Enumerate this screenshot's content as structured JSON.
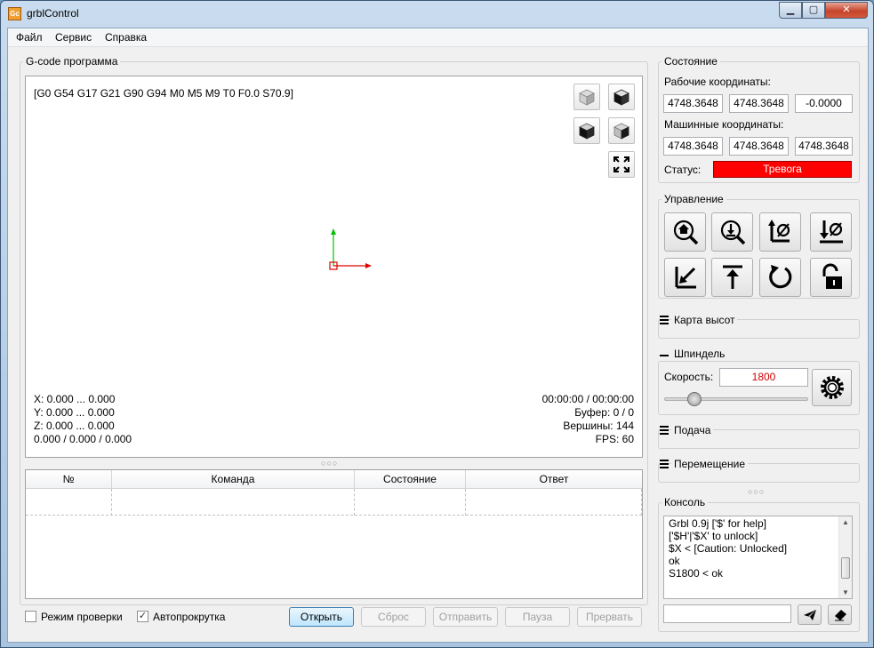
{
  "window": {
    "title": "grblControl",
    "app_icon_text": "Gc"
  },
  "menu": {
    "items": [
      "Файл",
      "Сервис",
      "Справка"
    ]
  },
  "program": {
    "group_title": "G-code программа",
    "gcode_header": "[G0 G54 G17 G21 G90 G94 M0 M5 M9 T0 F0.0 S70.9]",
    "view_buttons": [
      "view-front-icon",
      "view-top-icon",
      "view-left-icon",
      "view-isometric-icon",
      "fit-view-icon"
    ],
    "bounds": {
      "x": "X: 0.000 ... 0.000",
      "y": "Y: 0.000 ... 0.000",
      "z": "Z: 0.000 ... 0.000",
      "size": "0.000 / 0.000 / 0.000"
    },
    "stats": {
      "time": "00:00:00 / 00:00:00",
      "buffer": "Буфер: 0 / 0",
      "vertices": "Вершины: 144",
      "fps": "FPS: 60"
    }
  },
  "table": {
    "columns": [
      "№",
      "Команда",
      "Состояние",
      "Ответ"
    ]
  },
  "bottom_bar": {
    "check_mode": {
      "label": "Режим проверки",
      "checked": false
    },
    "autoscroll": {
      "label": "Автопрокрутка",
      "checked": true
    },
    "buttons": {
      "open": "Открыть",
      "reset": "Сброс",
      "send": "Отправить",
      "pause": "Пауза",
      "abort": "Прервать"
    }
  },
  "state": {
    "group_title": "Состояние",
    "work_coords_label": "Рабочие координаты:",
    "work_coords": [
      "4748.3648",
      "4748.3648",
      "-0.0000"
    ],
    "machine_coords_label": "Машинные координаты:",
    "machine_coords": [
      "4748.3648",
      "4748.3648",
      "4748.3648"
    ],
    "status_label": "Статус:",
    "status_value": "Тревога",
    "status_color": "#ff0000"
  },
  "control": {
    "group_title": "Управление",
    "buttons": [
      "home-icon",
      "probe-z-icon",
      "zero-xy-icon",
      "zero-z-icon",
      "return-xy-icon",
      "safe-z-icon",
      "restore-origin-icon",
      "unlock-icon"
    ]
  },
  "heightmap": {
    "title": "Карта высот"
  },
  "spindle": {
    "title": "Шпиндель",
    "speed_label": "Скорость:",
    "speed_value": "1800",
    "speed_color": "#cc0000",
    "slider_level": 0.05
  },
  "feed": {
    "title": "Подача"
  },
  "jog": {
    "title": "Перемещение"
  },
  "console": {
    "title": "Консоль",
    "lines": [
      "Grbl 0.9j ['$' for help]",
      "['$H'|'$X' to unlock]",
      "$X < [Caution: Unlocked]",
      "ok",
      "S1800 < ok"
    ],
    "input_value": ""
  }
}
